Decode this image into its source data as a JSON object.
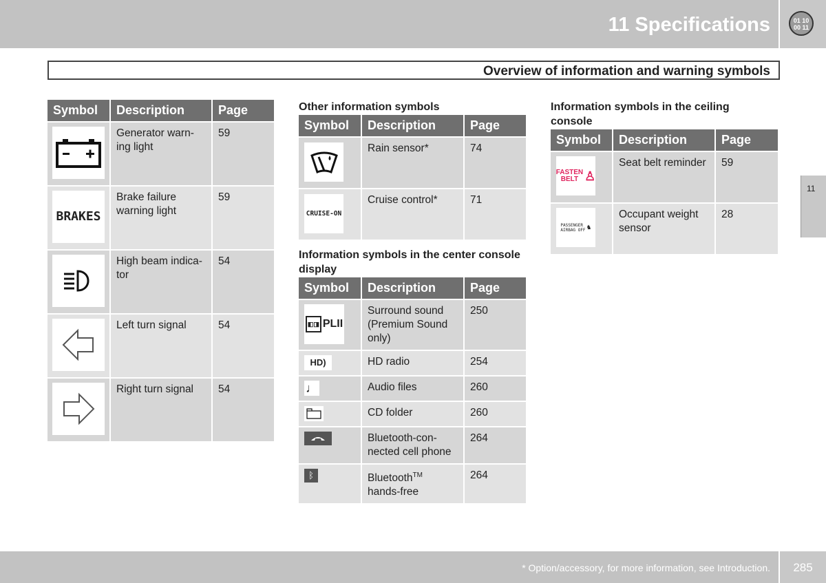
{
  "header": {
    "chapter_title": "11 Specifications",
    "chapter_icon_text": [
      "01 10",
      "00 11"
    ],
    "section_title": "Overview of information and warning symbols"
  },
  "columns": {
    "symbol": "Symbol",
    "description": "Description",
    "page": "Page"
  },
  "warning_table": {
    "rows": [
      {
        "icon": "battery-icon",
        "description": "Generator warn-ing light",
        "page": "59"
      },
      {
        "icon": "brakes-text-icon",
        "icon_text": "BRAKES",
        "description": "Brake failure warning light",
        "page": "59"
      },
      {
        "icon": "high-beam-icon",
        "description": "High beam indica-tor",
        "page": "54"
      },
      {
        "icon": "left-arrow-icon",
        "description": "Left turn signal",
        "page": "54"
      },
      {
        "icon": "right-arrow-icon",
        "description": "Right turn signal",
        "page": "54"
      }
    ]
  },
  "other_table": {
    "title": "Other information symbols",
    "rows": [
      {
        "icon": "rain-sensor-icon",
        "description": "Rain sensor*",
        "page": "74"
      },
      {
        "icon": "cruise-on-icon",
        "icon_text": "CRUISE-ON",
        "description": "Cruise control*",
        "page": "71"
      }
    ]
  },
  "center_table": {
    "title": "Information symbols in the center console display",
    "rows": [
      {
        "icon": "dolby-plii-icon",
        "icon_text": "PLII",
        "description": "Surround sound (Premium Sound only)",
        "page": "250"
      },
      {
        "icon": "hd-radio-icon",
        "icon_text": "HD",
        "description": "HD radio",
        "page": "254"
      },
      {
        "icon": "music-note-icon",
        "description": "Audio files",
        "page": "260"
      },
      {
        "icon": "folder-icon",
        "description": "CD folder",
        "page": "260"
      },
      {
        "icon": "phone-icon",
        "description": "Bluetooth-con-nected cell phone",
        "page": "264"
      },
      {
        "icon": "bluetooth-icon",
        "description": "Bluetooth",
        "sup": "TM",
        "description2": "hands-free",
        "page": "264"
      }
    ]
  },
  "ceiling_table": {
    "title": "Information symbols in the ceiling console",
    "rows": [
      {
        "icon": "fasten-belt-icon",
        "icon_text": [
          "FASTEN",
          "BELT"
        ],
        "description": "Seat belt reminder",
        "page": "59"
      },
      {
        "icon": "passenger-airbag-off-icon",
        "icon_text": [
          "PASSENGER",
          "AIRBAG OFF"
        ],
        "description": "Occupant weight sensor",
        "page": "28"
      }
    ]
  },
  "side_tab": "11",
  "footer": {
    "note": "* Option/accessory, for more information, see Introduction.",
    "page_number": "285"
  },
  "colors": {
    "header_gray": "#c2c2c2",
    "table_header": "#6f6f6f",
    "accent_pink": "#e0245e"
  }
}
